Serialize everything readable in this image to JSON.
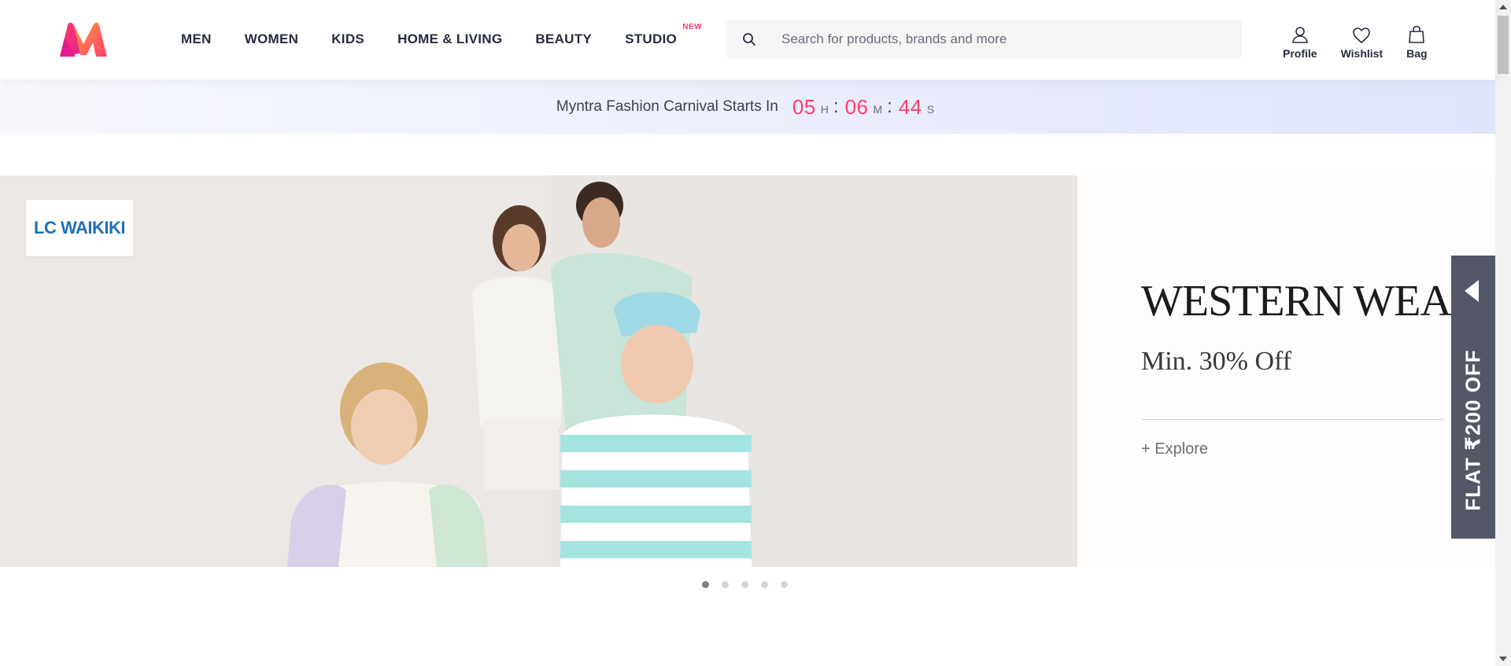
{
  "nav": {
    "items": [
      {
        "label": "MEN"
      },
      {
        "label": "WOMEN"
      },
      {
        "label": "KIDS"
      },
      {
        "label": "HOME & LIVING"
      },
      {
        "label": "BEAUTY"
      },
      {
        "label": "STUDIO",
        "badge": "NEW"
      }
    ]
  },
  "search": {
    "placeholder": "Search for products, brands and more",
    "icon": "search-icon"
  },
  "actions": {
    "profile": {
      "label": "Profile",
      "icon": "user-icon"
    },
    "wishlist": {
      "label": "Wishlist",
      "icon": "heart-icon"
    },
    "bag": {
      "label": "Bag",
      "icon": "bag-icon"
    }
  },
  "countdown": {
    "text": "Myntra Fashion Carnival Starts In",
    "hours": "05",
    "hours_unit": "H",
    "minutes": "06",
    "minutes_unit": "M",
    "seconds": "44",
    "seconds_unit": "S",
    "separator": ":"
  },
  "banner": {
    "brand": "LC WAIKIKI",
    "title": "WESTERN WEAR",
    "subtitle": "Min. 30% Off",
    "cta": "+ Explore",
    "slides": 5,
    "active_slide": 1
  },
  "side_tab": {
    "text": "FLAT ₹200 OFF"
  },
  "colors": {
    "accent": "#ff3f6c",
    "text": "#282c3f",
    "side_tab_bg": "#535766",
    "brand_blue": "#1e6fb6"
  }
}
